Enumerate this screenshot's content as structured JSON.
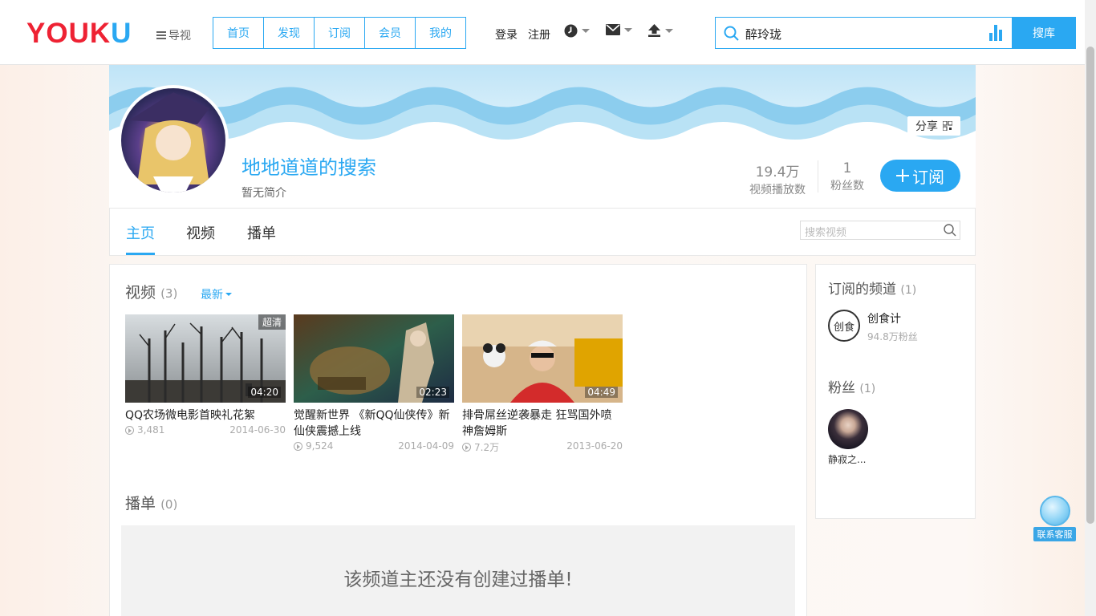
{
  "header": {
    "logo": {
      "part1": "YOU",
      "part2": "K",
      "part3": "U"
    },
    "guide_label": "导视",
    "nav_tabs": [
      "首页",
      "发现",
      "订阅",
      "会员",
      "我的"
    ],
    "login": "登录",
    "register": "注册",
    "icons": [
      "clock-icon",
      "mail-icon",
      "upload-icon"
    ],
    "search": {
      "value": "醉玲珑",
      "button": "搜库"
    }
  },
  "channel": {
    "name": "地地道道的搜索",
    "description": "暂无简介",
    "share_label": "分享",
    "stats": [
      {
        "value": "19.4万",
        "label": "视频播放数"
      },
      {
        "value": "1",
        "label": "粉丝数"
      }
    ],
    "subscribe_label": "订阅"
  },
  "tabs": {
    "items": [
      "主页",
      "视频",
      "播单"
    ],
    "active": "主页",
    "search_placeholder": "搜索视频"
  },
  "videos": {
    "heading": "视频",
    "count": "(3)",
    "sort_label": "最新",
    "items": [
      {
        "title": "QQ农场微电影首映礼花絮",
        "plays": "3,481",
        "date": "2014-06-30",
        "duration": "04:20",
        "badge": "超清"
      },
      {
        "title": "觉醒新世界 《新QQ仙侠传》新仙侠震撼上线",
        "plays": "9,524",
        "date": "2014-04-09",
        "duration": "02:23",
        "badge": ""
      },
      {
        "title": "排骨屌丝逆袭暴走 狂骂国外喷神詹姆斯",
        "plays": "7.2万",
        "date": "2013-06-20",
        "duration": "04:49",
        "badge": ""
      }
    ]
  },
  "playlists": {
    "heading": "播单",
    "count": "(0)",
    "empty_text": "该频道主还没有创建过播单!"
  },
  "sidebar": {
    "subscribed_heading": "订阅的频道",
    "subscribed_count": "(1)",
    "subscribed": [
      {
        "name": "创食计",
        "fans": "94.8万粉丝",
        "logo_text": "创食"
      }
    ],
    "fans_heading": "粉丝",
    "fans_count": "(1)",
    "fans": [
      {
        "name": "静寂之..."
      }
    ]
  },
  "support": {
    "label": "联系客服"
  },
  "colors": {
    "accent": "#2aa8f2",
    "logo_red": "#ee2233"
  }
}
